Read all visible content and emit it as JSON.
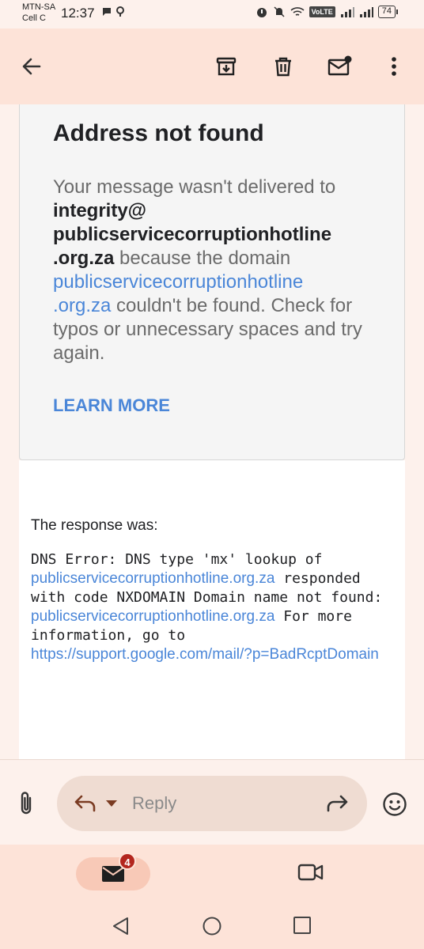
{
  "status_bar": {
    "carrier_1": "MTN-SA",
    "carrier_2": "Cell C",
    "time": "12:37",
    "volte": "VoLTE",
    "battery": "74"
  },
  "message": {
    "title": "Address not found",
    "body_prefix": "Your message wasn't delivered to ",
    "recipient_line1": "integrity@",
    "recipient_line2": "publicservicecorruptionhotline",
    "recipient_line3": ".org.za",
    "body_mid": " because the domain ",
    "domain_link_line1": "publicservicecorruptionhotline",
    "domain_link_line2": ".org.za",
    "body_suffix": " couldn't be found. Check for typos or unnecessary spaces and try again.",
    "learn_more": "LEARN MORE"
  },
  "response": {
    "label": "The response was:",
    "dns_part1": "DNS Error: DNS type 'mx' lookup of ",
    "dns_link1": "publicservicecorruptionhotline.org.za",
    "dns_part2": " responded with code NXDOMAIN Domain name not found: ",
    "dns_link2": "publicservicecorruptionhotline.org.za",
    "dns_part3": " For more information, go to ",
    "dns_link3": "https://support.google.com/mail/?p=BadRcptDomain"
  },
  "reply_bar": {
    "reply_label": "Reply"
  },
  "bottom_nav": {
    "mail_badge": "4"
  },
  "icons": {
    "back": "arrow-left-icon",
    "archive": "archive-icon",
    "delete": "trash-icon",
    "mark_unread": "mail-unread-icon",
    "more": "more-vert-icon"
  },
  "colors": {
    "accent": "#4a86d8",
    "badge": "#b3261e",
    "toolbar_bg": "#fde3d8"
  }
}
